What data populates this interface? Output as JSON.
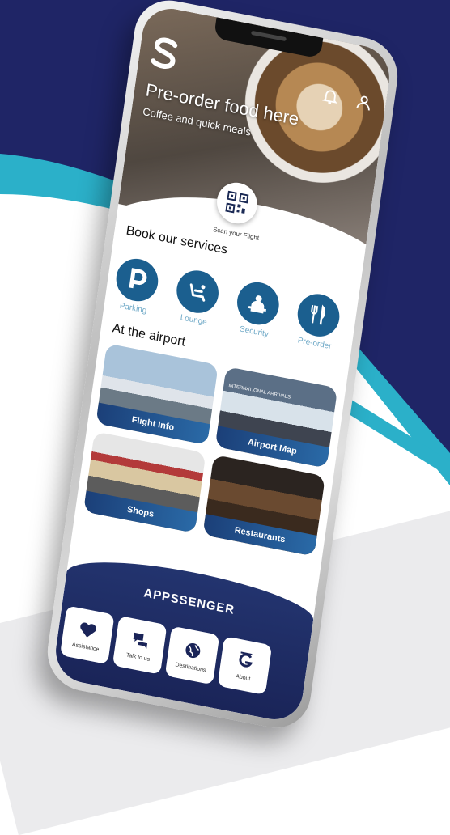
{
  "hero": {
    "title": "Pre-order food here",
    "subtitle": "Coffee and quick meals"
  },
  "scan": {
    "label": "Scan your Flight"
  },
  "services": {
    "title": "Book our services",
    "items": [
      {
        "label": "Parking",
        "icon": "parking-icon"
      },
      {
        "label": "Lounge",
        "icon": "lounge-seat-icon"
      },
      {
        "label": "Security",
        "icon": "security-officer-icon"
      },
      {
        "label": "Pre-order",
        "icon": "cutlery-icon"
      }
    ]
  },
  "airport": {
    "title": "At the airport",
    "tiles": [
      {
        "label": "Flight Info"
      },
      {
        "label": "Airport Map",
        "sign_text": "INTERNATIONAL ARRIVALS"
      },
      {
        "label": "Shops"
      },
      {
        "label": "Restaurants"
      }
    ]
  },
  "footer": {
    "brand": "APPSSENGER",
    "nav": [
      {
        "label": "Assistance",
        "icon": "heart-icon"
      },
      {
        "label": "Talk to us",
        "icon": "chat-icon"
      },
      {
        "label": "Destinations",
        "icon": "globe-icon"
      },
      {
        "label": "About",
        "icon": "logo-g-icon"
      }
    ]
  },
  "colors": {
    "navy": "#1f2566",
    "accent": "#1b5f8f",
    "light_blue": "#6fa9c7"
  }
}
